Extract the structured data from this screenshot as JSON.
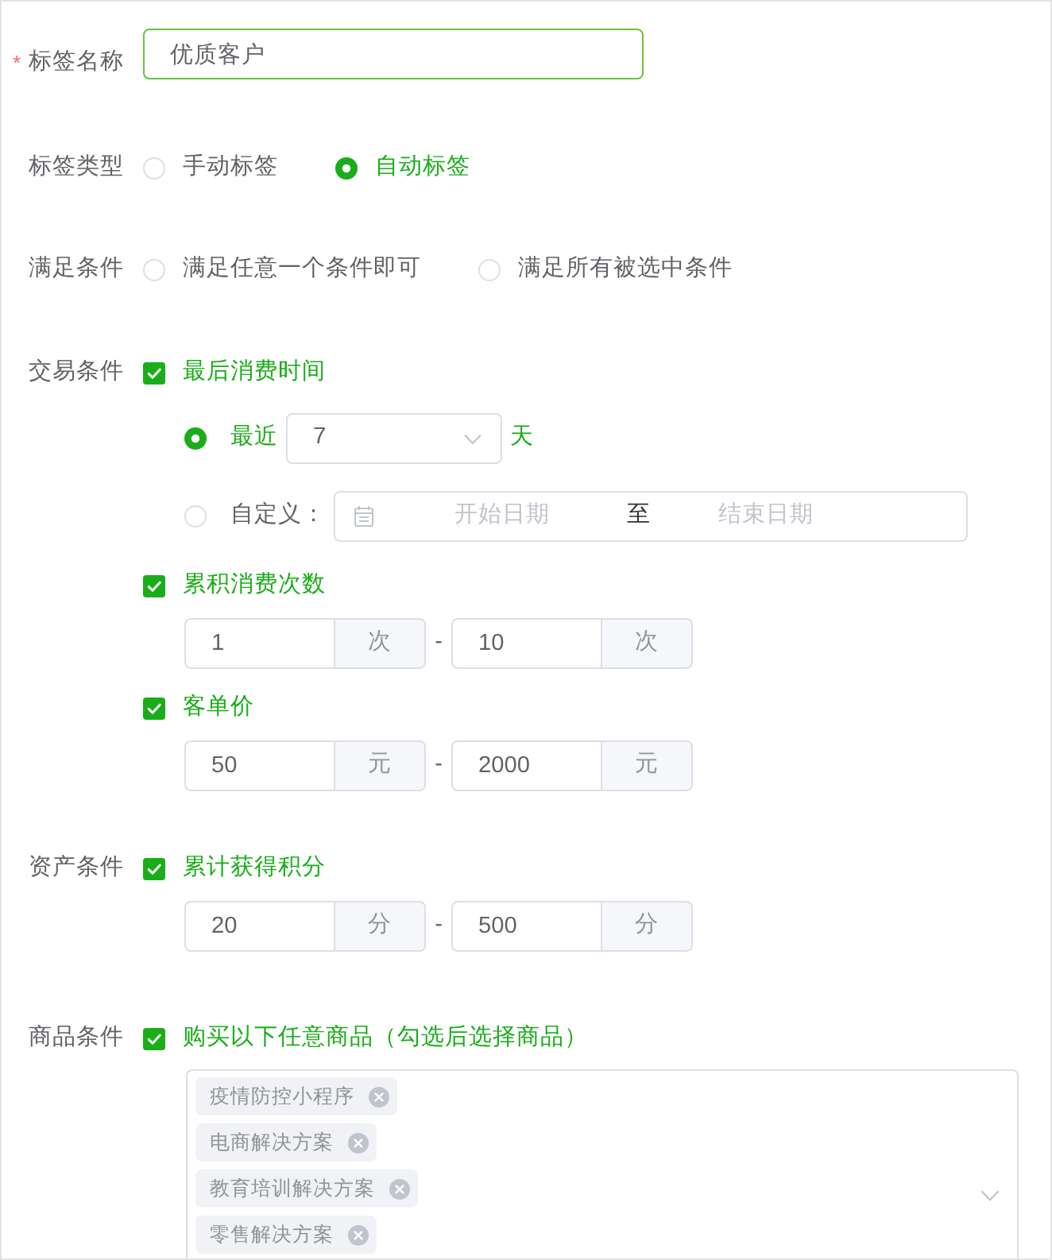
{
  "form": {
    "name_field": {
      "required_mark": "*",
      "label": "标签名称",
      "value": "优质客户",
      "focused": true
    },
    "tag_type": {
      "label": "标签类型",
      "options": [
        {
          "label": "手动标签",
          "selected": false
        },
        {
          "label": "自动标签",
          "selected": true
        }
      ]
    },
    "match_rule": {
      "label": "满足条件",
      "options": [
        {
          "label": "满足任意一个条件即可",
          "selected": false
        },
        {
          "label": "满足所有被选中条件",
          "selected": false
        }
      ]
    },
    "sections": [
      {
        "label": "交易条件",
        "conditions": [
          {
            "kind": "time",
            "label": "最后消费时间",
            "checked": true,
            "recent": {
              "label": "最近",
              "selected": true,
              "value": "7",
              "unit": "天"
            },
            "custom": {
              "label": "自定义：",
              "selected": false,
              "start": {
                "placeholder": "开始日期"
              },
              "separator": "至",
              "end": {
                "placeholder": "结束日期"
              }
            }
          },
          {
            "kind": "range",
            "label": "累积消费次数",
            "checked": true,
            "min": {
              "value": "1",
              "unit": "次"
            },
            "separator": "-",
            "max": {
              "value": "10",
              "unit": "次"
            }
          },
          {
            "kind": "range",
            "label": "客单价",
            "checked": true,
            "min": {
              "value": "50",
              "unit": "元"
            },
            "separator": "-",
            "max": {
              "value": "2000",
              "unit": "元"
            }
          }
        ]
      },
      {
        "label": "资产条件",
        "conditions": [
          {
            "kind": "range",
            "label": "累计获得积分",
            "checked": true,
            "min": {
              "value": "20",
              "unit": "分"
            },
            "separator": "-",
            "max": {
              "value": "500",
              "unit": "分"
            }
          }
        ]
      },
      {
        "label": "商品条件",
        "conditions": [
          {
            "kind": "products",
            "label": "购买以下任意商品（勾选后选择商品）",
            "checked": true,
            "selected_products": [
              {
                "label": "疫情防控小程序"
              },
              {
                "label": "电商解决方案"
              },
              {
                "label": "教育培训解决方案"
              },
              {
                "label": "零售解决方案"
              }
            ]
          }
        ]
      }
    ]
  }
}
